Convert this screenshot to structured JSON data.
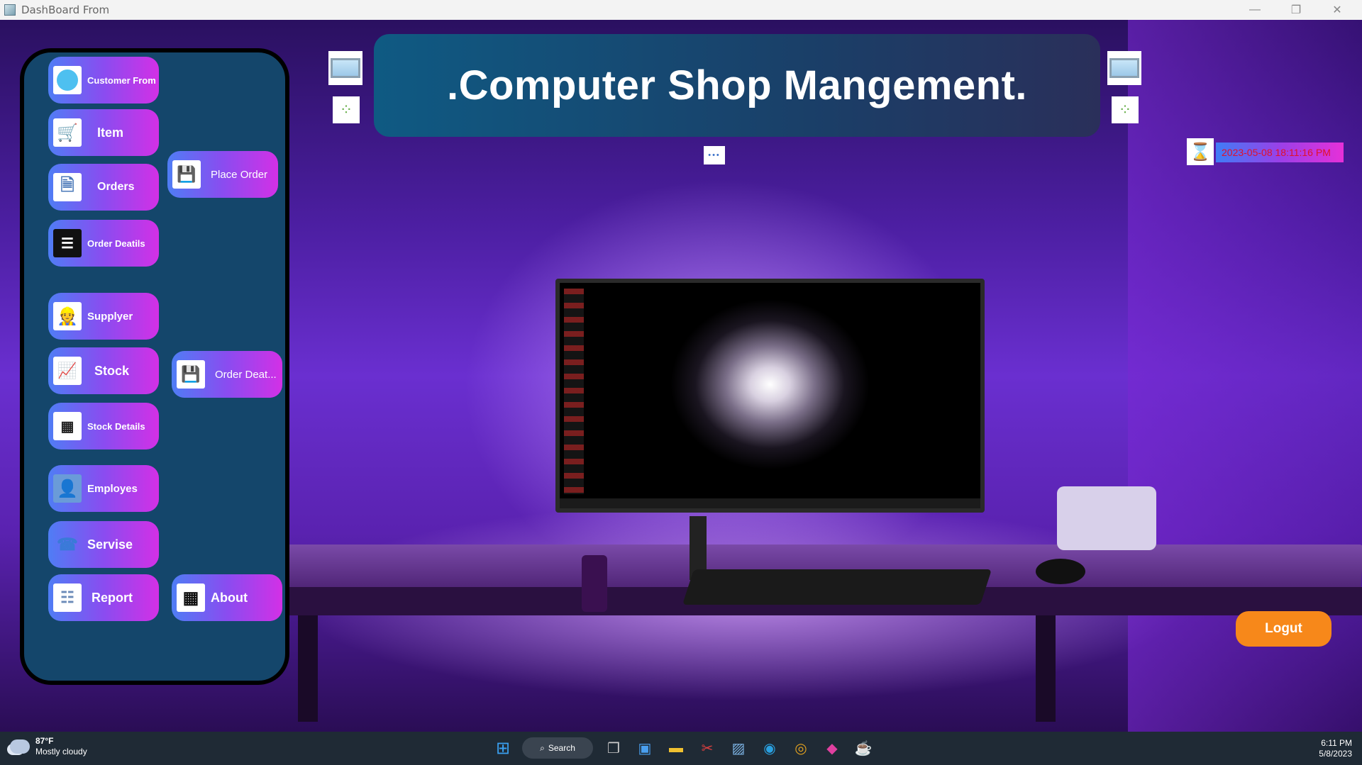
{
  "window": {
    "title": "DashBoard From",
    "minimize_glyph": "—",
    "maximize_glyph": "❐",
    "close_glyph": "✕"
  },
  "header": {
    "title": ".Computer Shop Mangement."
  },
  "sidebar": {
    "buttons": [
      {
        "label": "Customer From",
        "icon": "customer-icon"
      },
      {
        "label": "Item",
        "icon": "cart-icon"
      },
      {
        "label": "Orders",
        "icon": "orders-icon"
      },
      {
        "label": "Order Deatils",
        "icon": "order-details-icon"
      },
      {
        "label": "Supplyer",
        "icon": "supplier-icon"
      },
      {
        "label": "Stock",
        "icon": "stock-chart-icon"
      },
      {
        "label": "Stock Details",
        "icon": "stock-details-icon"
      },
      {
        "label": "Employes",
        "icon": "employee-icon"
      },
      {
        "label": "Servise",
        "icon": "service-icon"
      },
      {
        "label": "Report",
        "icon": "report-icon"
      },
      {
        "label": "Place Order",
        "icon": "floppy-icon"
      },
      {
        "label": "Order Deat...",
        "icon": "floppy-check-icon"
      },
      {
        "label": "About",
        "icon": "grid-icon"
      }
    ]
  },
  "datetime": "2023-05-08   18:11:16 PM",
  "logout_label": "Logut",
  "taskbar": {
    "weather_temp": "87°F",
    "weather_condition": "Mostly cloudy",
    "search_label": "Search",
    "clock_time": "6:11 PM",
    "clock_date": "5/8/2023"
  },
  "colors": {
    "panel": "#14466b",
    "button_gradient_start": "#4f7df5",
    "button_gradient_end": "#d330e6",
    "logout": "#f7881a",
    "datetime_text": "#e0102a"
  }
}
